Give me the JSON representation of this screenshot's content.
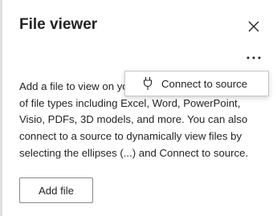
{
  "panel": {
    "title": "File viewer",
    "description": "Add a file to view on your report page from a variety of file types including Excel, Word, PowerPoint, Visio, PDFs, 3D models, and more. You can also connect to a source to dynamically view files by selecting the ellipses (...) and Connect to source.",
    "add_file_label": "Add file"
  },
  "menu": {
    "connect_label": "Connect to source",
    "connect_icon": "plug-icon"
  },
  "icons": {
    "close": "close-icon",
    "more": "more-options-icon"
  }
}
